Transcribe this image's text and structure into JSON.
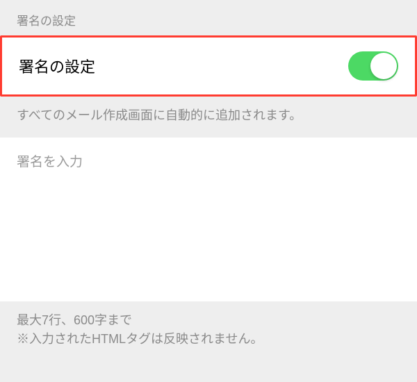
{
  "header": {
    "title": "署名の設定"
  },
  "signature_toggle": {
    "label": "署名の設定",
    "enabled": true
  },
  "caption": "すべてのメール作成画面に自動的に追加されます。",
  "signature_input": {
    "placeholder": "署名を入力",
    "value": ""
  },
  "footer": {
    "line1": "最大7行、600字まで",
    "line2": "※入力されたHTMLタグは反映されません。"
  },
  "colors": {
    "toggle_on": "#4cd964",
    "highlight_border": "#ff3b30",
    "background": "#eeeeee"
  }
}
